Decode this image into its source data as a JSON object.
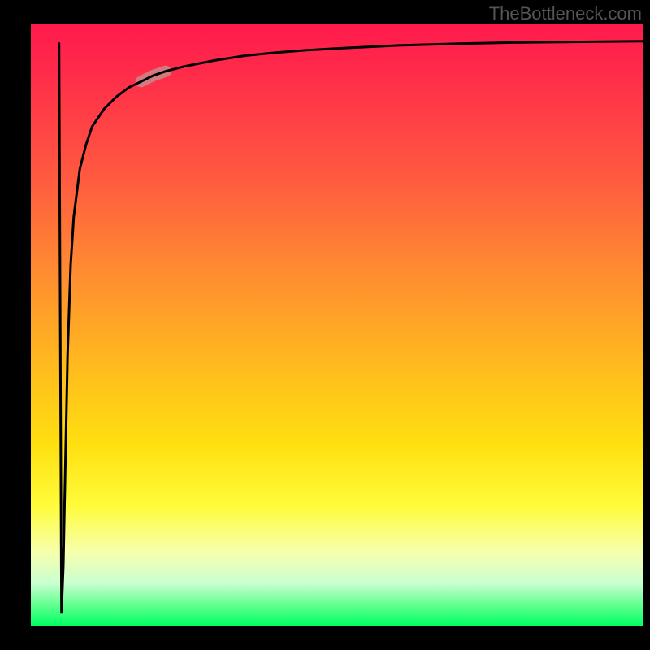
{
  "watermark": "TheBottleneck.com",
  "chart_data": {
    "type": "line",
    "title": "",
    "xlabel": "",
    "ylabel": "",
    "xlim": [
      0,
      100
    ],
    "ylim": [
      0,
      100
    ],
    "grid": false,
    "series": [
      {
        "name": "curve",
        "x": [
          5,
          5.3,
          5.6,
          6,
          6.5,
          7,
          8,
          9,
          10,
          12,
          14,
          16,
          18,
          20,
          22,
          25,
          30,
          35,
          40,
          45,
          50,
          60,
          70,
          80,
          90,
          100
        ],
        "y": [
          2,
          10,
          25,
          45,
          60,
          68,
          76,
          80,
          83,
          86,
          88,
          89.5,
          90.5,
          91.5,
          92.2,
          93,
          94,
          94.8,
          95.3,
          95.7,
          96,
          96.5,
          96.8,
          97,
          97.1,
          97.2
        ]
      }
    ],
    "highlight_segment": {
      "x_range": [
        18,
        24
      ],
      "color": "#c98a8a"
    },
    "background_gradient": {
      "top": "#ff1a4d",
      "mid": "#ffe010",
      "bottom": "#00ff66"
    }
  }
}
